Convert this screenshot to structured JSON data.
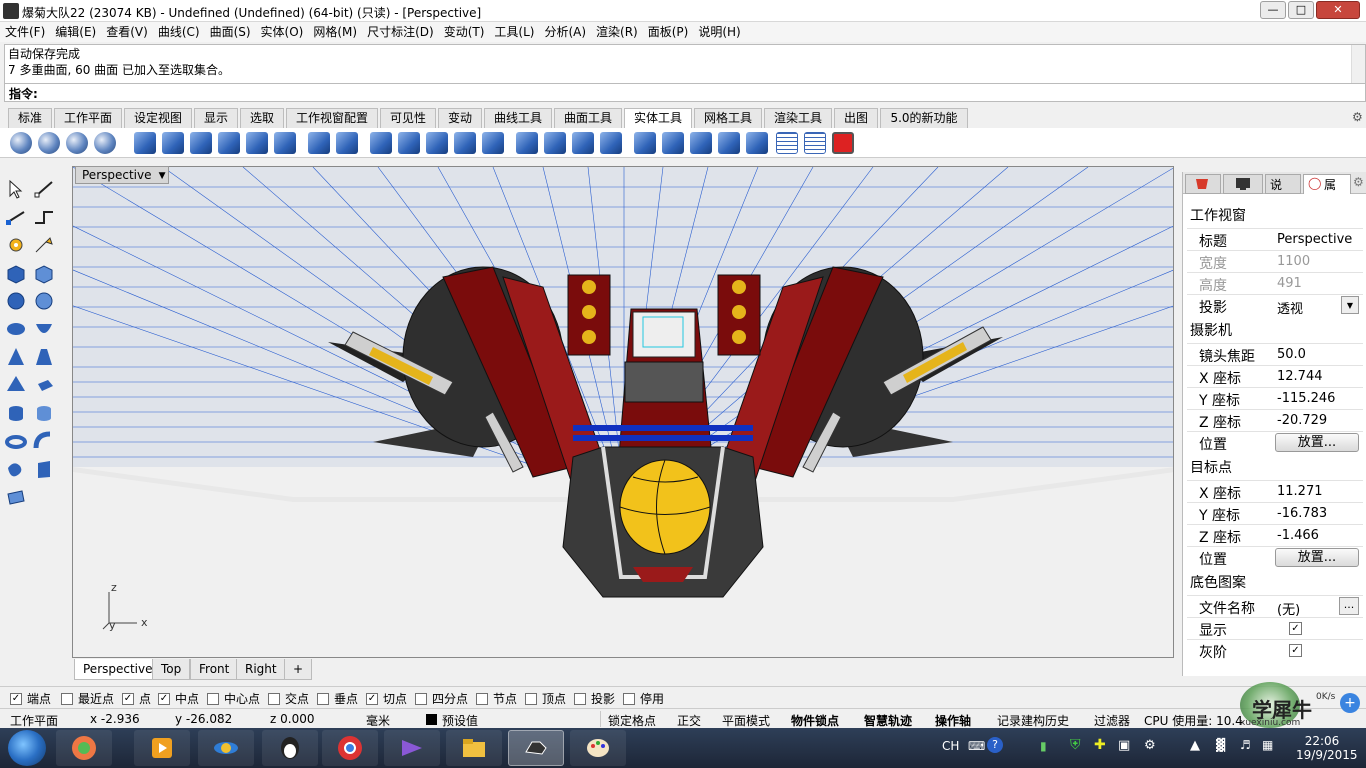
{
  "window": {
    "title": "爆菊大队22 (23074 KB) - Undefined (Undefined) (64-bit) (只读) - [Perspective]",
    "controls": [
      "minimize-button",
      "maximize-button",
      "close-button"
    ]
  },
  "menu": [
    "文件(F)",
    "编辑(E)",
    "查看(V)",
    "曲线(C)",
    "曲面(S)",
    "实体(O)",
    "网格(M)",
    "尺寸标注(D)",
    "变动(T)",
    "工具(L)",
    "分析(A)",
    "渲染(R)",
    "面板(P)",
    "说明(H)"
  ],
  "command": {
    "history": [
      "自动保存完成",
      "7 多重曲面, 60 曲面 已加入至选取集合。"
    ],
    "prompt_label": "指令:",
    "input_value": ""
  },
  "toolbar_tabs": [
    "标准",
    "工作平面",
    "设定视图",
    "显示",
    "选取",
    "工作视窗配置",
    "可见性",
    "变动",
    "曲线工具",
    "曲面工具",
    "实体工具",
    "网格工具",
    "渲染工具",
    "出图",
    "5.0的新功能"
  ],
  "active_toolbar_tab": "实体工具",
  "toolbar_icons": [
    "boolean-union-icon",
    "boolean-difference-icon",
    "boolean-intersection-icon",
    "boolean-split-icon",
    "cap-planar-holes-icon",
    "extract-surface-icon",
    "merge-faces-icon",
    "fillet-edges-icon",
    "offset-solid-icon",
    "solid-points-icon",
    "extrude-face-icon",
    "move-face-icon",
    "move-edge-icon",
    "split-face-icon",
    "fold-face-icon",
    "rotate-face-icon",
    "make-hole-icon",
    "move-hole-icon",
    "copy-hole-icon",
    "place-hole-icon",
    "array-hole-icon",
    "delete-hole-icon",
    "box-tool-icon",
    "cylinder-tool-icon",
    "cone-tool-icon",
    "pipe-tool-icon",
    "solid-edit-icon",
    "grid-array-icon",
    "grid-polar-icon",
    "delete-solid-icon"
  ],
  "viewport": {
    "label": "Perspective",
    "axis_labels": {
      "z": "z",
      "x": "x",
      "y": "y"
    },
    "tabs": [
      "Perspective",
      "Top",
      "Front",
      "Right"
    ],
    "add_tab_symbol": "+"
  },
  "panel": {
    "tabs": [
      "图层",
      "显示",
      "说",
      "属"
    ],
    "section_viewport": "工作视窗",
    "title_label": "标题",
    "title_value": "Perspective",
    "width_label": "宽度",
    "width_value": "1100",
    "height_label": "高度",
    "height_value": "491",
    "projection_label": "投影",
    "projection_value": "透视",
    "section_camera": "摄影机",
    "focal_label": "镜头焦距",
    "focal_value": "50.0",
    "cam_x_label": "X 座标",
    "cam_x_value": "12.744",
    "cam_y_label": "Y 座标",
    "cam_y_value": "-115.246",
    "cam_z_label": "Z 座标",
    "cam_z_value": "-20.729",
    "cam_pos_label": "位置",
    "cam_place_button": "放置...",
    "section_target": "目标点",
    "tgt_x_label": "X 座标",
    "tgt_x_value": "11.271",
    "tgt_y_label": "Y 座标",
    "tgt_y_value": "-16.783",
    "tgt_z_label": "Z 座标",
    "tgt_z_value": "-1.466",
    "tgt_pos_label": "位置",
    "tgt_place_button": "放置...",
    "section_wallpaper": "底色图案",
    "filename_label": "文件名称",
    "filename_value": "(无)",
    "filename_button": "...",
    "show_label": "显示",
    "show_checked": true,
    "gray_label": "灰阶",
    "gray_checked": true
  },
  "osnaps": [
    {
      "label": "端点",
      "checked": true
    },
    {
      "label": "最近点",
      "checked": false
    },
    {
      "label": "点",
      "checked": true
    },
    {
      "label": "中点",
      "checked": true
    },
    {
      "label": "中心点",
      "checked": false
    },
    {
      "label": "交点",
      "checked": false
    },
    {
      "label": "垂点",
      "checked": false
    },
    {
      "label": "切点",
      "checked": true
    },
    {
      "label": "四分点",
      "checked": false
    },
    {
      "label": "节点",
      "checked": false
    },
    {
      "label": "顶点",
      "checked": false
    },
    {
      "label": "投影",
      "checked": false
    },
    {
      "label": "停用",
      "checked": false
    }
  ],
  "status": {
    "cplane": "工作平面",
    "x": "x -2.936",
    "y": "y -26.082",
    "z": "z 0.000",
    "units": "毫米",
    "layer": "预设值",
    "grid_snap": "锁定格点",
    "ortho": "正交",
    "planar": "平面模式",
    "osnap": "物件锁点",
    "smart_track": "智慧轨迹",
    "gumball": "操作轴",
    "history": "记录建构历史",
    "filter": "过滤器",
    "cpu": "CPU 使用量: 10.4"
  },
  "taskbar": {
    "lang": "CH",
    "time": "22:06",
    "date": "19/9/2015",
    "net_speed": "0K/s"
  },
  "watermark": {
    "text": "学犀牛",
    "url": "xuexiniu.com"
  },
  "colors": {
    "viewport_bg": "#bfc2c6",
    "grid_line": "#2b5fd0",
    "accent_gold": "#e5b41b",
    "hull_red": "#7a0c0c",
    "hull_dark": "#3a3a3a"
  }
}
